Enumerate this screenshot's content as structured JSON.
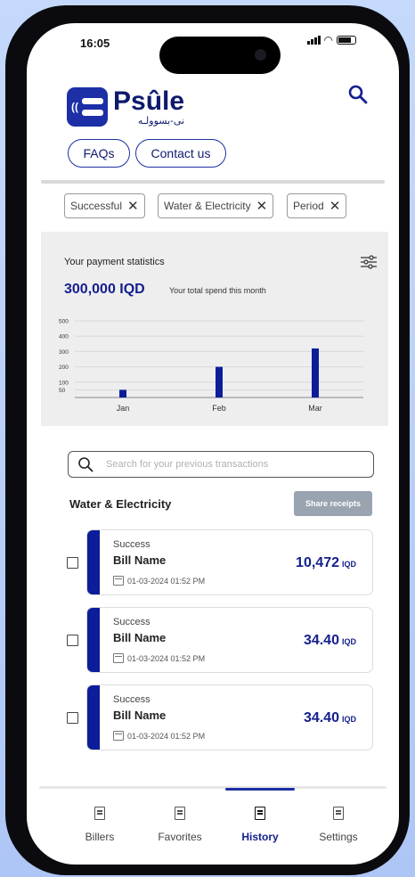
{
  "status_bar": {
    "time": "16:05"
  },
  "brand": {
    "name": "Psûle",
    "arabic": "نى-بسوولـه"
  },
  "header": {
    "faqs_label": "FAQs",
    "contact_label": "Contact us"
  },
  "filters": [
    "Successful",
    "Water & Electricity",
    "Period"
  ],
  "stats": {
    "title": "Your payment statistics",
    "amount": "300,000 IQD",
    "subtitle": "Your total spend this month"
  },
  "chart_data": {
    "type": "bar",
    "categories": [
      "Jan",
      "Feb",
      "Mar"
    ],
    "values": [
      50,
      200,
      320
    ],
    "y_ticks": [
      50,
      100,
      200,
      300,
      400,
      500
    ],
    "ylim": [
      0,
      500
    ],
    "grid": true,
    "bar_color": "#0c1d9a"
  },
  "transactions_section": {
    "search_placeholder": "Search for your previous transactions",
    "title": "Water & Electricity",
    "share_label": "Share receipts"
  },
  "transactions": [
    {
      "status": "Success",
      "name": "Bill Name",
      "date": "01-03-2024 01:52 PM",
      "amount": "10,472",
      "currency": "IQD"
    },
    {
      "status": "Success",
      "name": "Bill Name",
      "date": "01-03-2024 01:52 PM",
      "amount": "34.40",
      "currency": "IQD"
    },
    {
      "status": "Success",
      "name": "Bill Name",
      "date": "01-03-2024 01:52 PM",
      "amount": "34.40",
      "currency": "IQD"
    }
  ],
  "nav": {
    "items": [
      {
        "label": "Billers",
        "icon": "receipt-icon",
        "active": false
      },
      {
        "label": "Favorites",
        "icon": "receipt-icon",
        "active": false
      },
      {
        "label": "History",
        "icon": "receipt-icon",
        "active": true
      },
      {
        "label": "Settings",
        "icon": "receipt-icon",
        "active": false
      }
    ]
  },
  "colors": {
    "primary": "#14208c",
    "accent": "#1c2fa6",
    "card_bar": "#0c1d9a",
    "share_button": "#9aa3b0"
  }
}
